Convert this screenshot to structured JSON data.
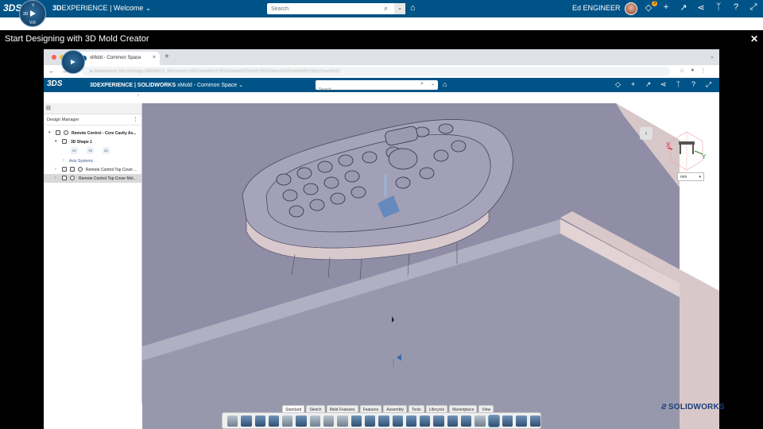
{
  "topbar": {
    "logo": "3DS",
    "brand_prefix": "3D",
    "brand_name": "EXPERIENCE",
    "brand_sep": "|",
    "app_name": "Welcome",
    "search_placeholder": "Search",
    "user": "Ed ENGINEER",
    "notif_count": "3",
    "compass_labels": [
      "3D",
      "V",
      "V.R"
    ]
  },
  "video": {
    "title": "Start Designing with 3D Mold Creator",
    "close_label": "✕"
  },
  "browser": {
    "tab_title": "xMold - Common Space",
    "url_blurred": "■ 3dexperience.3ds.com/#app:SWXMOLD_AP/content:X3DContentId=%7B%22data%22%3A%7B%22items%22%3A%5B%7B%22envId%22",
    "colors": {
      "red": "#ff5f57",
      "yellow": "#febc2e",
      "green": "#28c840"
    }
  },
  "app": {
    "logo": "3DS",
    "brand": "3DEXPERIENCE | SOLIDWORKS",
    "space": "xMold - Common Space",
    "search_placeholder": "Search"
  },
  "design_manager": {
    "title": "Design Manager",
    "tree": [
      {
        "label": "Remote Control - Core Cavity As...",
        "level": 0
      },
      {
        "label": "3D Shape 1",
        "level": 1
      },
      {
        "label": "Axis Systems",
        "level": 2
      },
      {
        "label": "Remote Control Top Cover ...",
        "level": 1
      },
      {
        "label": "Remote Control Top Cover Mol...",
        "level": 1,
        "selected": true
      }
    ],
    "planes": [
      "XY",
      "YZ",
      "ZX"
    ]
  },
  "viewport": {
    "unit": "mm",
    "axis_x": "X",
    "axis_y": "Y"
  },
  "command_tabs": [
    "Standard",
    "Sketch",
    "Mold Features",
    "Features",
    "Assembly",
    "Tools",
    "Lifecycle",
    "Marketplace",
    "View"
  ],
  "command_active_tab": "Standard",
  "watermark": "SOLIDWORKS"
}
